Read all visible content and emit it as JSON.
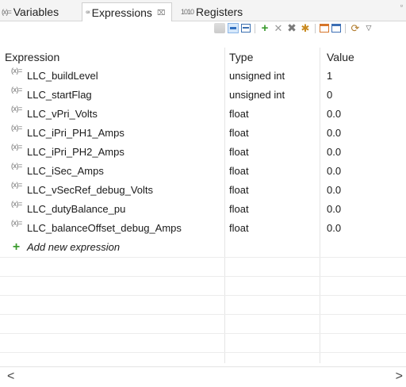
{
  "tabs": {
    "variables": {
      "icon": "(x)=",
      "label": "Variables"
    },
    "expressions": {
      "icon": "⁶ˣ",
      "label": "Expressions",
      "close": "⌧"
    },
    "registers": {
      "icon": "1010",
      "label": "Registers"
    },
    "minimize": "▫"
  },
  "toolbar": {
    "items": [
      "collapse-all-icon",
      "show-type-names-icon",
      "layout-icon",
      "add-expression-icon",
      "remove-icon",
      "remove-all-icon",
      "refresh-icon",
      "new-window-icon",
      "pin-window-icon",
      "link-icon",
      "view-menu-icon"
    ]
  },
  "table": {
    "headers": {
      "expression": "Expression",
      "type": "Type",
      "value": "Value"
    },
    "rows": [
      {
        "expression": "LLC_buildLevel",
        "type": "unsigned int",
        "value": "1"
      },
      {
        "expression": "LLC_startFlag",
        "type": "unsigned int",
        "value": "0"
      },
      {
        "expression": "LLC_vPri_Volts",
        "type": "float",
        "value": "0.0"
      },
      {
        "expression": "LLC_iPri_PH1_Amps",
        "type": "float",
        "value": "0.0"
      },
      {
        "expression": "LLC_iPri_PH2_Amps",
        "type": "float",
        "value": "0.0"
      },
      {
        "expression": "LLC_iSec_Amps",
        "type": "float",
        "value": "0.0"
      },
      {
        "expression": "LLC_vSecRef_debug_Volts",
        "type": "float",
        "value": "0.0"
      },
      {
        "expression": "LLC_dutyBalance_pu",
        "type": "float",
        "value": "0.0"
      },
      {
        "expression": "LLC_balanceOffset_debug_Amps",
        "type": "float",
        "value": "0.0"
      }
    ],
    "add_label": "Add new expression",
    "row_icon": "(x)="
  },
  "scrollbar": {
    "left": "<",
    "right": ">"
  }
}
